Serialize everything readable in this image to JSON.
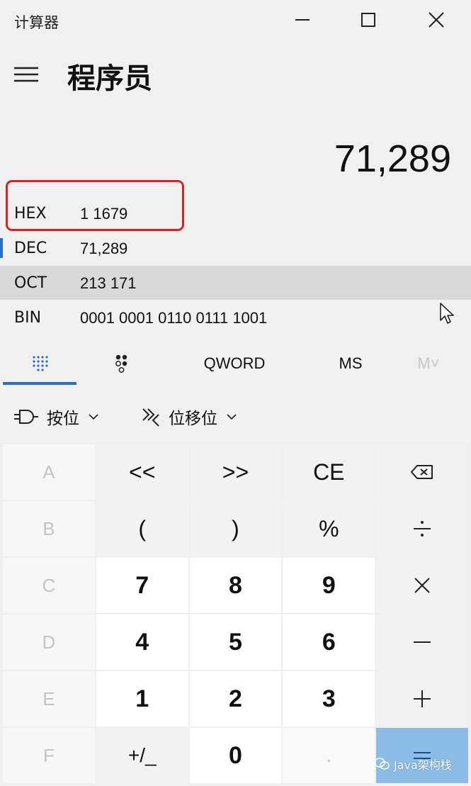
{
  "window": {
    "title": "计算器",
    "controls": {
      "minimize": "minimize-icon",
      "maximize": "maximize-icon",
      "close": "close-icon"
    }
  },
  "header": {
    "mode": "程序员",
    "result": "71,289"
  },
  "radix": [
    {
      "name": "HEX",
      "value": "1 1679"
    },
    {
      "name": "DEC",
      "value": "71,289"
    },
    {
      "name": "OCT",
      "value": "213 171"
    },
    {
      "name": "BIN",
      "value": "0001 0001 0110 0111 1001"
    }
  ],
  "toolbar": {
    "word_size": "QWORD",
    "memory_store": "MS",
    "memory_recall": "M˅"
  },
  "functions": {
    "bitwise": "按位",
    "bitshift": "位移位"
  },
  "keys": [
    [
      "A",
      "«",
      "»",
      "CE",
      "backspace-icon"
    ],
    [
      "B",
      "(",
      ")",
      "%",
      "divide-icon"
    ],
    [
      "C",
      "7",
      "8",
      "9",
      "multiply-icon"
    ],
    [
      "D",
      "4",
      "5",
      "6",
      "minus-icon"
    ],
    [
      "E",
      "1",
      "2",
      "3",
      "plus-icon"
    ],
    [
      "F",
      "+/−",
      "0",
      ".",
      "equals-icon"
    ]
  ],
  "key_labels": {
    "a": "A",
    "lshift": "<<",
    "rshift": ">>",
    "ce": "CE",
    "b": "B",
    "lparen": "(",
    "rparen": ")",
    "percent": "%",
    "c": "C",
    "seven": "7",
    "eight": "8",
    "nine": "9",
    "d": "D",
    "four": "4",
    "five": "5",
    "six": "6",
    "e": "E",
    "one": "1",
    "two": "2",
    "three": "3",
    "f": "F",
    "negate": "+/_",
    "zero": "0",
    "decimal": "."
  },
  "watermark": "Java架构栈",
  "colors": {
    "accent": "#2b6cc4",
    "highlight_box": "#e02020",
    "equals_bg": "#8cbde8"
  }
}
